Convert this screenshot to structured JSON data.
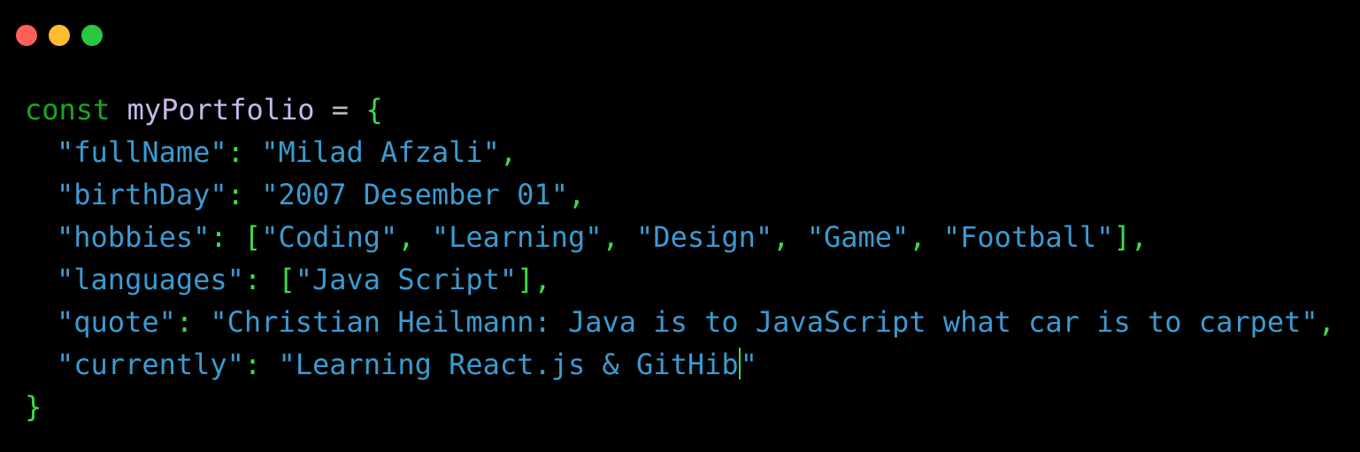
{
  "window": {
    "controls": {
      "close_color": "#ff5f57",
      "minimize_color": "#febc2e",
      "maximize_color": "#28c840"
    }
  },
  "code": {
    "keyword": "const",
    "variable": "myPortfolio",
    "assign": "=",
    "open_brace": "{",
    "close_brace": "}",
    "fields": {
      "fullName_key": "\"fullName\"",
      "fullName_value": "\"Milad Afzali\"",
      "birthDay_key": "\"birthDay\"",
      "birthDay_value": "\"2007 Desember 01\"",
      "hobbies_key": "\"hobbies\"",
      "hobbies_values": [
        "\"Coding\"",
        "\"Learning\"",
        "\"Design\"",
        "\"Game\"",
        "\"Football\""
      ],
      "languages_key": "\"languages\"",
      "languages_values": [
        "\"Java Script\""
      ],
      "quote_key": "\"quote\"",
      "quote_value": "\"Christian Heilmann: Java is to JavaScript what car is to carpet\"",
      "currently_key": "\"currently\"",
      "currently_value_text": "\"Learning React.js & GitHib",
      "currently_value_close": "\""
    },
    "colors": {
      "keyword": "#1ea51e",
      "punctuation": "#3ddc49",
      "string": "#3b9bd0",
      "identifier": "#c8b8e8",
      "caret": "#3ddc49"
    }
  }
}
